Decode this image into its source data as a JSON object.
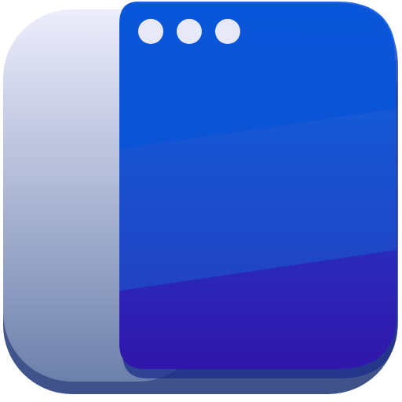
{
  "app_icon": {
    "name": "window-sidebar-app-icon",
    "colors": {
      "base_dark": "#4a5f92",
      "sidebar_top": "#ececfb",
      "sidebar_bottom": "#6f82ac",
      "panel_top": "#0a55d8",
      "panel_mid": "#1657d2",
      "panel_bottom": "#2b19ad",
      "panel_shadow": "#1b2f8e",
      "dots": "#e8e9f8"
    },
    "window_controls": {
      "count": 3,
      "icons": [
        "window-control-dot-icon",
        "window-control-dot-icon",
        "window-control-dot-icon"
      ]
    }
  }
}
